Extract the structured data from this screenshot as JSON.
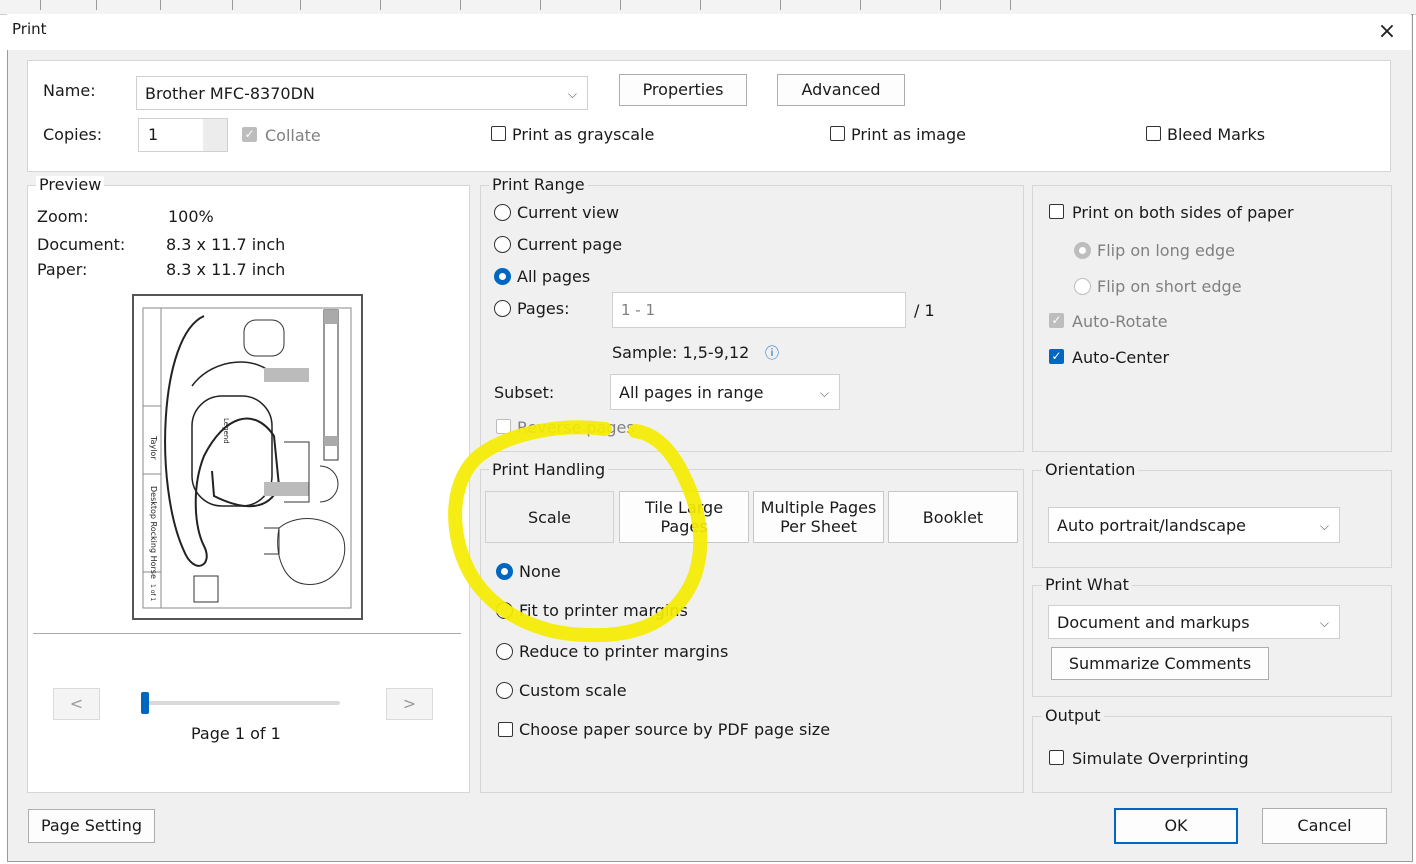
{
  "dialog": {
    "title": "Print",
    "close_glyph": "×"
  },
  "printer": {
    "name_label": "Name:",
    "name_value": "Brother MFC-8370DN",
    "properties_label": "Properties",
    "advanced_label": "Advanced",
    "copies_label": "Copies:",
    "copies_value": "1",
    "collate_label": "Collate",
    "grayscale_label": "Print as grayscale",
    "image_label": "Print as image",
    "bleed_label": "Bleed Marks"
  },
  "preview": {
    "legend": "Preview",
    "zoom_label": "Zoom:",
    "zoom_value": "100%",
    "document_label": "Document:",
    "document_value": "8.3 x 11.7 inch",
    "paper_label": "Paper:",
    "paper_value": "8.3 x 11.7 inch",
    "prev_label": "<",
    "next_label": ">",
    "page_text": "Page 1 of 1",
    "page_fraction": 0.0,
    "thumb_texts": {
      "title": "Desktop Rocking Horse",
      "author": "Taylor",
      "legend": "Legend",
      "page": "1 of 1"
    }
  },
  "print_range": {
    "legend": "Print Range",
    "current_view": "Current view",
    "current_page": "Current page",
    "all_pages": "All pages",
    "pages_label": "Pages:",
    "pages_value": "1 - 1",
    "pages_total": "/ 1",
    "sample_text": "Sample: 1,5-9,12",
    "info_icon": "ⓘ",
    "subset_label": "Subset:",
    "subset_value": "All pages in range",
    "reverse_label": "Reverse pages"
  },
  "print_handling": {
    "legend": "Print Handling",
    "tabs": [
      "Scale",
      "Tile Large Pages",
      "Multiple Pages Per Sheet",
      "Booklet"
    ],
    "none_label": "None",
    "fit_label": "Fit to printer margins",
    "reduce_label": "Reduce to printer margins",
    "custom_label": "Custom scale",
    "paper_source_label": "Choose paper source by PDF page size"
  },
  "duplex": {
    "both_sides_label": "Print on both sides of paper",
    "flip_long_label": "Flip on long edge",
    "flip_short_label": "Flip on short edge",
    "auto_rotate_label": "Auto-Rotate",
    "auto_center_label": "Auto-Center"
  },
  "orientation": {
    "legend": "Orientation",
    "value": "Auto portrait/landscape"
  },
  "print_what": {
    "legend": "Print What",
    "value": "Document and markups",
    "summarize_label": "Summarize Comments"
  },
  "output": {
    "legend": "Output",
    "simulate_label": "Simulate Overprinting"
  },
  "footer": {
    "page_setting_label": "Page Setting",
    "ok_label": "OK",
    "cancel_label": "Cancel"
  },
  "colors": {
    "accent": "#0067c0",
    "highlight": "#f5ec00"
  }
}
